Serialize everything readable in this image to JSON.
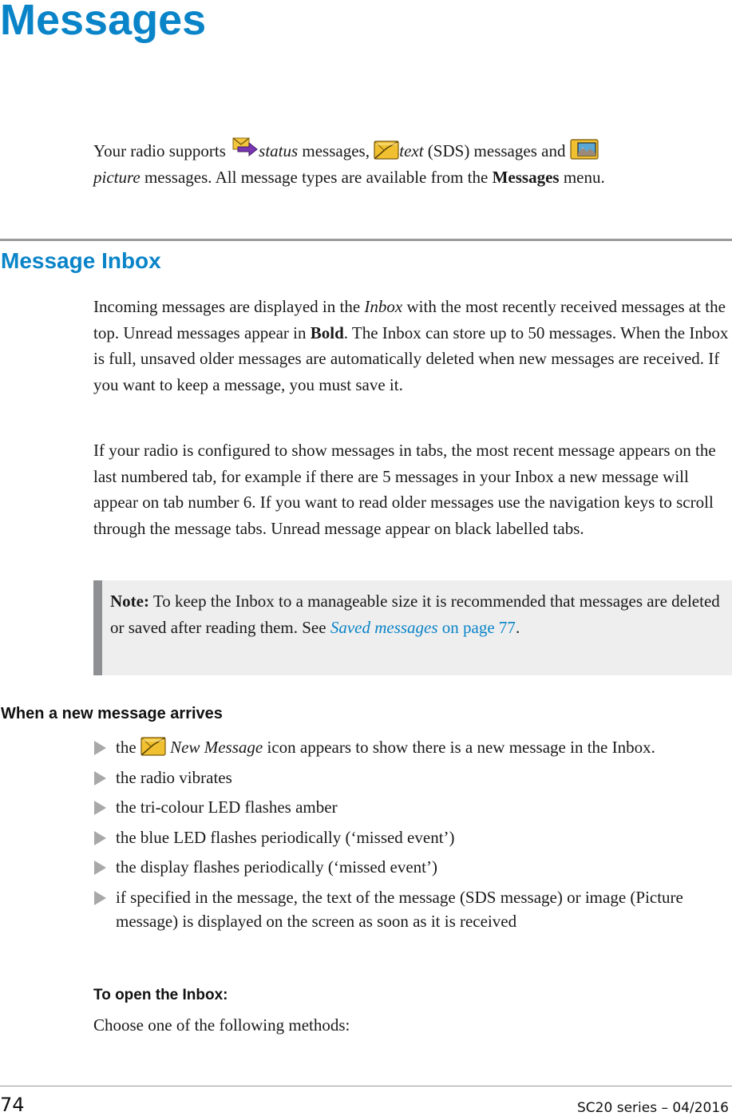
{
  "page": {
    "title": "Messages",
    "intro": {
      "t1": "Your radio supports ",
      "status_word": "status",
      "t2": " messages, ",
      "text_word": "text",
      "t3": " (SDS) messages and ",
      "picture_word": "picture",
      "t4": " messages. All message types are available from the ",
      "menu_name": "Messages",
      "t5": " menu.",
      "icons": [
        "status-message-icon",
        "text-message-icon",
        "picture-message-icon"
      ]
    },
    "section": {
      "heading": "Message Inbox",
      "p1": {
        "t1": "Incoming messages are displayed in the ",
        "inbox_word": "Inbox",
        "t2": " with the most recently received messages at the top. Unread messages appear in ",
        "bold_word": "Bold",
        "t3": ". The Inbox can store up to 50 messages. When the Inbox is full, unsaved older messages are automatically deleted when new messages are received. If you want to keep a message, you must save it."
      },
      "p2": "If your radio is configured to show messages in tabs, the most recent message appears on the last numbered tab, for example if there are 5 messages in your Inbox a new message will appear on tab number 6. If you want to read older messages use the navigation keys to scroll through the message tabs. Unread message appear on black labelled tabs.",
      "note": {
        "label": "Note:",
        "text": "  To keep the Inbox to a manageable size it is recommended that messages are deleted or saved after reading them. See ",
        "link_italic": "Saved messages",
        "link_rest": " on page 77",
        "end": "."
      }
    },
    "arrival": {
      "heading": "When a new message arrives",
      "bullet1": {
        "t1": "the ",
        "icon_label": "New Message",
        "t2": " icon appears to show there is a new message in the Inbox."
      },
      "bullets": [
        "the radio vibrates",
        "the tri-colour LED flashes amber",
        "the blue LED flashes periodically (‘missed event’)",
        "the display flashes periodically (‘missed event’)",
        "if specified in the message, the text of the message (SDS message) or image (Picture message) is displayed on the screen as soon as it is received"
      ]
    },
    "procedure": {
      "heading": "To open the Inbox:",
      "text": "Choose one of the following methods:"
    },
    "footer": {
      "page_number": "74",
      "series": "SC20 series – 04/2016"
    },
    "colors": {
      "heading_blue": "#0a84c8",
      "rule_gray": "#9a9a9a",
      "note_bg": "#eeeeee",
      "note_bar": "#8f9094",
      "bullet_gray": "#a8a8a8"
    }
  }
}
